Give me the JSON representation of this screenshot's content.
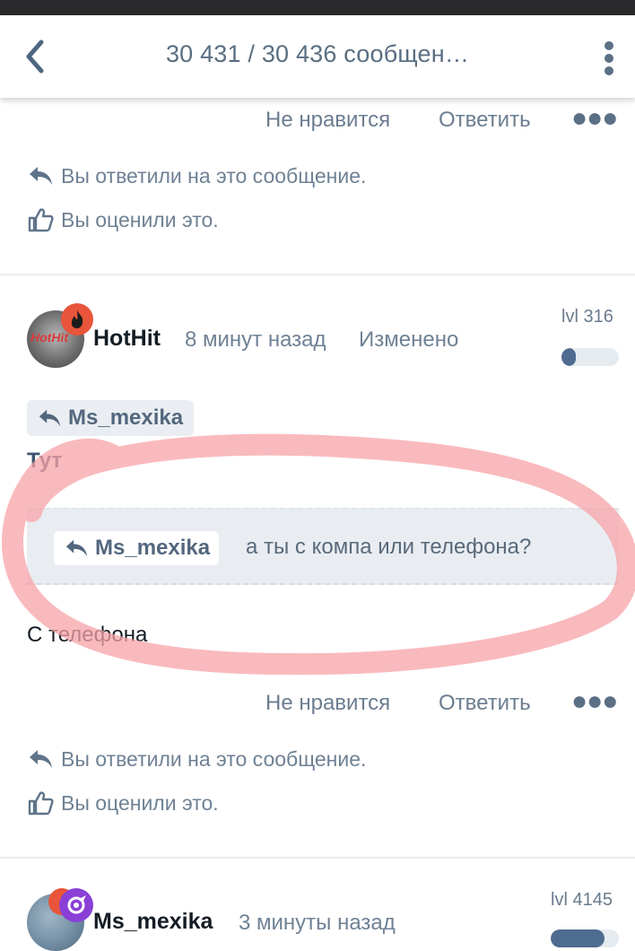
{
  "header": {
    "title": "30 431 / 30 436 сообщен…"
  },
  "post_prev": {
    "dislike": "Не нравится",
    "reply": "Ответить",
    "replied_note": "Вы ответили на это сообщение.",
    "liked_note": "Вы оценили это."
  },
  "post_hothit": {
    "avatar_text": "HotHit",
    "username": "HotHit",
    "time": "8 минут назад",
    "edited": "Изменено",
    "level": "lvl 316",
    "level_fill": 0.25,
    "mention": "Ms_mexika",
    "text1": "Тут",
    "quote_mention": "Ms_mexika",
    "quote_text": "а ты с компа или телефона?",
    "text2": "С телефона",
    "dislike": "Не нравится",
    "reply": "Ответить",
    "replied_note": "Вы ответили на это сообщение.",
    "liked_note": "Вы оценили это."
  },
  "post_mexika": {
    "username": "Ms_mexika",
    "time": "3 минуты назад",
    "level": "lvl 4145"
  },
  "colors": {
    "accent": "#4e6b90",
    "text_muted": "#6f8194",
    "badge_fire": "#e8553a",
    "badge_purple": "#8a3fd6",
    "scribble": "#f7a3a8"
  }
}
